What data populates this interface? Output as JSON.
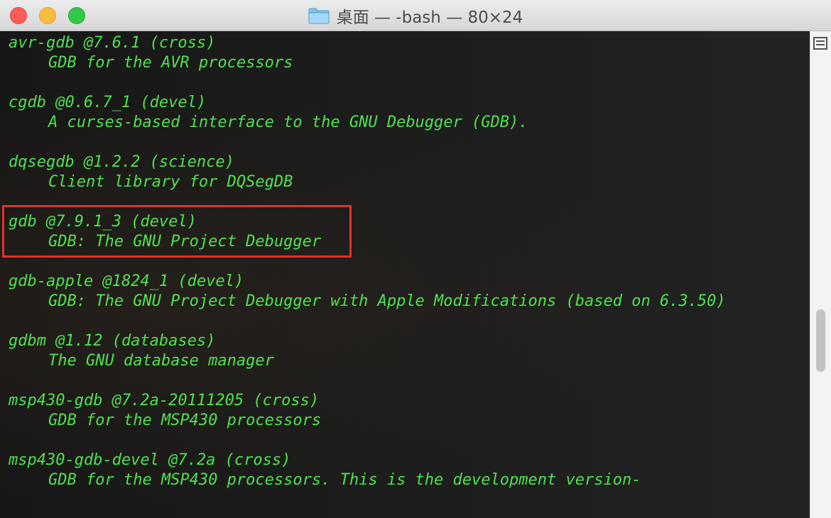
{
  "window": {
    "title": "桌面 — -bash — 80×24",
    "folder_icon": "folder-icon"
  },
  "colors": {
    "text": "#4ee24e",
    "highlight": "#e3312a",
    "close": "#fc5d57",
    "minimize": "#fdbc40",
    "zoom": "#34c84a"
  },
  "terminal": {
    "lines": [
      {
        "kind": "pkg",
        "text": "avr-gdb @7.6.1 (cross)"
      },
      {
        "kind": "desc",
        "text": "GDB for the AVR processors"
      },
      {
        "kind": "pkg",
        "text": "cgdb @0.6.7_1 (devel)"
      },
      {
        "kind": "desc",
        "text": "A curses-based interface to the GNU Debugger (GDB)."
      },
      {
        "kind": "pkg",
        "text": "dqsegdb @1.2.2 (science)"
      },
      {
        "kind": "desc",
        "text": "Client library for DQSegDB"
      },
      {
        "kind": "pkg",
        "text": "gdb @7.9.1_3 (devel)"
      },
      {
        "kind": "desc",
        "text": "GDB: The GNU Project Debugger"
      },
      {
        "kind": "pkg",
        "text": "gdb-apple @1824_1 (devel)"
      },
      {
        "kind": "desc",
        "text": "GDB: The GNU Project Debugger with Apple Modifications (based on 6.3.50)"
      },
      {
        "kind": "pkg",
        "text": "gdbm @1.12 (databases)"
      },
      {
        "kind": "desc",
        "text": "The GNU database manager"
      },
      {
        "kind": "pkg",
        "text": "msp430-gdb @7.2a-20111205 (cross)"
      },
      {
        "kind": "desc",
        "text": "GDB for the MSP430 processors"
      },
      {
        "kind": "pkg",
        "text": "msp430-gdb-devel @7.2a (cross)"
      },
      {
        "kind": "desc",
        "text": "GDB for the MSP430 processors. This is the development version-"
      }
    ]
  }
}
